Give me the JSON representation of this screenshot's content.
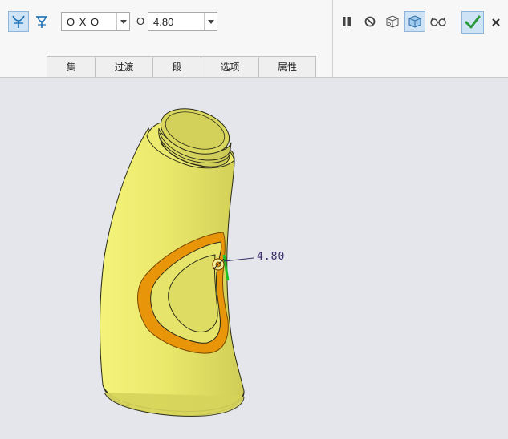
{
  "toolbar": {
    "mode_buttons": [
      {
        "icon": "round-set-mode-icon",
        "active": true
      },
      {
        "icon": "round-transition-mode-icon",
        "active": false
      }
    ],
    "shape_dropdown": {
      "value": "O X O"
    },
    "radius_label": "O",
    "radius_dropdown": {
      "value": "4.80"
    },
    "tabs": [
      "集",
      "过渡",
      "段",
      "选项",
      "属性"
    ],
    "right_controls": [
      {
        "icon": "pause-icon"
      },
      {
        "icon": "no-preview-icon"
      },
      {
        "icon": "preview-geometry-icon"
      },
      {
        "icon": "verify-mode-icon",
        "active": true
      },
      {
        "icon": "glasses-preview-icon"
      }
    ],
    "confirm": {
      "icon": "checkmark-icon"
    },
    "cancel": {
      "icon": "close-icon"
    }
  },
  "canvas": {
    "dimension_label": "4.80",
    "model_color": "#e8e670",
    "highlight_color": "#e8950a"
  }
}
